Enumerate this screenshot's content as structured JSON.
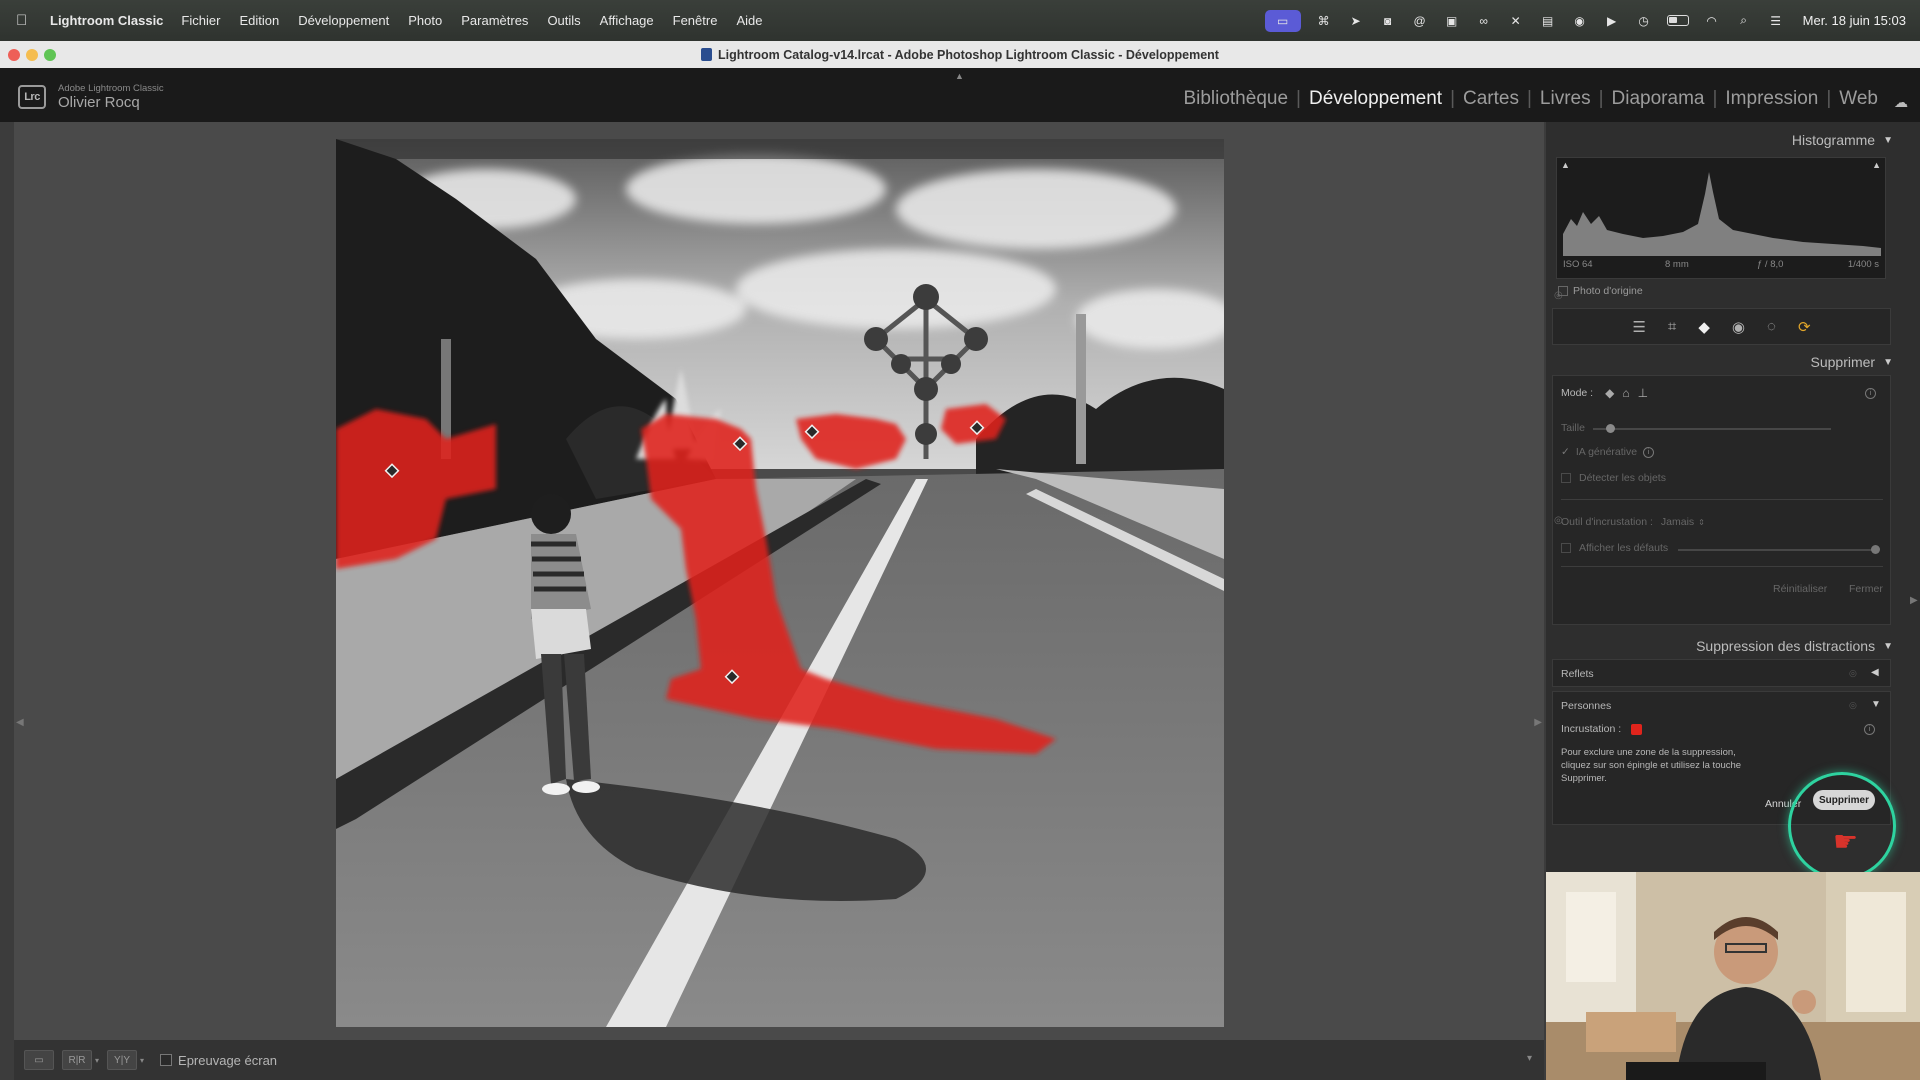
{
  "menubar": {
    "app_name": "Lightroom Classic",
    "items": [
      "Fichier",
      "Edition",
      "Développement",
      "Photo",
      "Paramètres",
      "Outils",
      "Affichage",
      "Fenêtre",
      "Aide"
    ],
    "clock": "Mer. 18 juin  15:03",
    "status_icons": [
      "screen-share-icon",
      "app-icon",
      "cursor-icon",
      "camera-icon",
      "at-icon",
      "app2-icon",
      "creative-cloud-icon",
      "x-icon",
      "clipboard-icon",
      "user-icon",
      "play-icon",
      "clock-icon",
      "battery-icon",
      "wifi-icon",
      "search-icon",
      "control-center-icon"
    ]
  },
  "window": {
    "title": "Lightroom Catalog-v14.lrcat - Adobe Photoshop Lightroom Classic - Développement"
  },
  "header": {
    "logo": "Lrc",
    "app_label": "Adobe Lightroom Classic",
    "user": "Olivier Rocq",
    "modules": [
      "Bibliothèque",
      "Développement",
      "Cartes",
      "Livres",
      "Diaporama",
      "Impression",
      "Web"
    ],
    "active_module": "Développement"
  },
  "histogram": {
    "title": "Histogramme",
    "iso": "ISO 64",
    "focal": "8 mm",
    "aperture": "ƒ / 8,0",
    "shutter": "1/400 s",
    "original_label": "Photo d'origine"
  },
  "remove_panel": {
    "title": "Supprimer",
    "mode_label": "Mode :",
    "size_label": "Taille",
    "size_value": 0.07,
    "generative_ai_label": "IA générative",
    "detect_objects_label": "Détecter les objets",
    "overlay_tool_label": "Outil d'incrustation :",
    "overlay_tool_value": "Jamais",
    "show_defaults_label": "Afficher les défauts",
    "reset_label": "Réinitialiser",
    "close_label": "Fermer"
  },
  "distraction_panel": {
    "title": "Suppression des distractions",
    "reflections_label": "Reflets",
    "people_label": "Personnes",
    "overlay_label": "Incrustation :",
    "overlay_color": "#e0241c",
    "help_text": [
      "Pour exclure une zone de la suppression,",
      "cliquez sur son épingle et utilisez la touche",
      "Supprimer."
    ],
    "cancel_label": "Annuler",
    "remove_label": "Supprimer"
  },
  "toolbar": {
    "soft_proof_label": "Epreuvage écran"
  },
  "colors": {
    "accent_ring": "#2ed3a0",
    "mask_red": "#e0241c",
    "active_tool_orange": "#e0a52a"
  }
}
